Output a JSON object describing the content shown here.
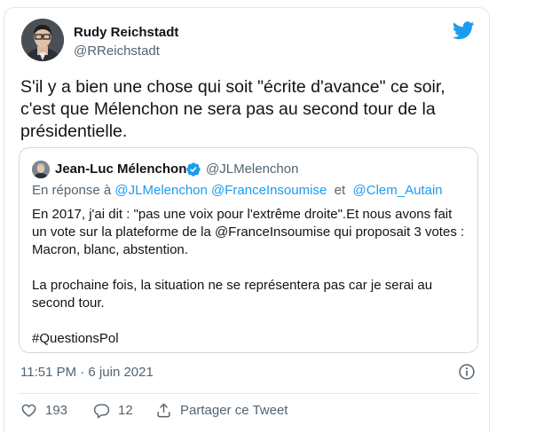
{
  "tweet": {
    "author_name": "Rudy Reichstadt",
    "author_handle": "@RReichstadt",
    "text_line1": "S'il y a bien une chose qui soit \"écrite d'avance\" ce soir,",
    "text_line2": "c'est que Mélenchon ne sera pas au second tour de la",
    "text_line3": "présidentielle.",
    "timestamp": "11:51 PM · 6 juin 2021"
  },
  "quoted": {
    "author_name": "Jean-Luc Mélenchon",
    "author_handle": "@JLMelenchon",
    "reply_prefix": "En réponse à",
    "reply_mention1": "@JLMelenchon",
    "reply_mention2": "@FranceInsoumise",
    "reply_conj": "et",
    "reply_mention3": "@Clem_Autain",
    "para1_line1": "En 2017, j'ai dit : \"pas une voix pour l'extrême droite\".Et nous avons fait",
    "para1_line2": "un vote sur la plateforme de la @FranceInsoumise qui proposait 3 votes :",
    "para1_line3": "Macron, blanc, abstention.",
    "para2_line1": "La prochaine fois, la situation ne se représentera pas car je serai au",
    "para2_line2": "second tour.",
    "hashtag": "#QuestionsPol"
  },
  "actions": {
    "likes": "193",
    "replies": "12",
    "share_label": "Partager ce Tweet"
  },
  "icons": {
    "brand": "twitter-bird-icon",
    "verified": "verified-badge-icon",
    "info": "info-icon",
    "like": "heart-icon",
    "reply": "reply-icon",
    "share": "share-icon"
  },
  "colors": {
    "brand": "#1d9bf0",
    "text": "#0f1419",
    "secondary": "#536471",
    "border": "#cfd9de"
  }
}
